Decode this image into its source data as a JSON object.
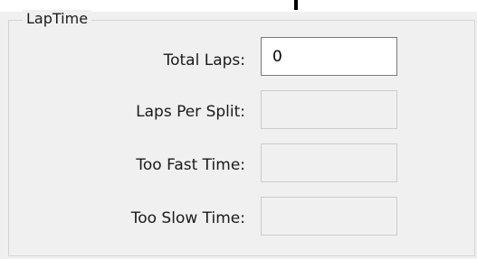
{
  "group": {
    "title": "LapTime"
  },
  "fields": {
    "total_laps": {
      "label": "Total Laps:",
      "value": "0"
    },
    "laps_per_split": {
      "label": "Laps Per Split:",
      "value": ""
    },
    "too_fast_time": {
      "label": "Too Fast Time:",
      "value": ""
    },
    "too_slow_time": {
      "label": "Too Slow Time:",
      "value": ""
    }
  }
}
